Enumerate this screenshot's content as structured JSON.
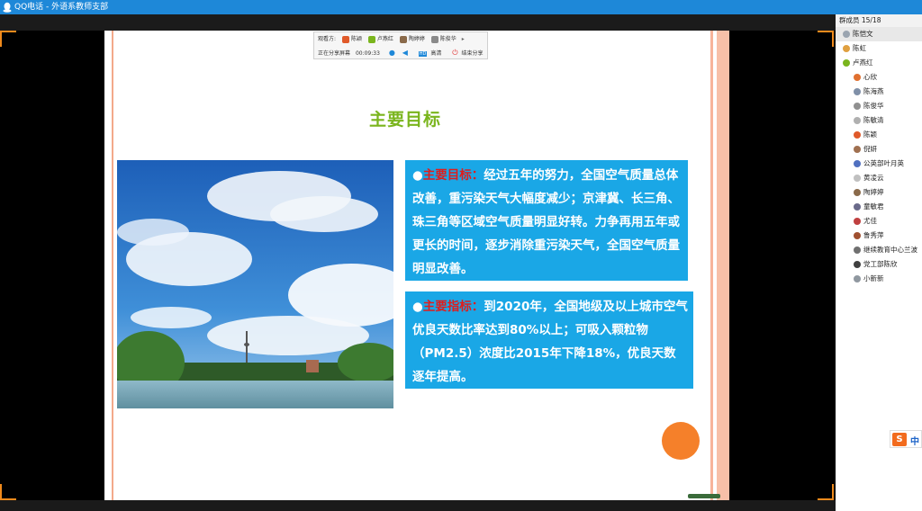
{
  "window": {
    "title": "QQ电话 - 外语系教师支部"
  },
  "share": {
    "viewers_label": "观看方:",
    "viewers": [
      {
        "name": "陈颖",
        "color": "#e05a2a"
      },
      {
        "name": "卢燕红",
        "color": "#7ab51d"
      },
      {
        "name": "陶婷婷",
        "color": "#8a6a4a"
      },
      {
        "name": "陈俊华",
        "color": "#8a8a8a"
      }
    ],
    "status": "正在分享屏幕",
    "time": "00:09:33",
    "quality": "高清",
    "end_label": "结束分享"
  },
  "slide": {
    "title": "主要目标",
    "box1_label": "主要目标：",
    "box1_text": "经过五年的努力，全国空气质量总体改善，重污染天气大幅度减少；京津冀、长三角、珠三角等区域空气质量明显好转。力争再用五年或更长的时间，逐步消除重污染天气，全国空气质量明显改善。",
    "box2_label": "主要指标：",
    "box2_text": "到2020年，全国地级及以上城市空气优良天数比率达到80%以上；可吸入颗粒物（PM2.5）浓度比2015年下降18%，优良天数逐年提高。"
  },
  "members": {
    "header": "群成员 15/18",
    "list": [
      {
        "name": "陈恺文",
        "color": "#9aa4b0",
        "indent": false,
        "selected": true
      },
      {
        "name": "陈虹",
        "color": "#e0a040",
        "indent": false
      },
      {
        "name": "卢燕红",
        "color": "#7ab51d",
        "indent": false
      },
      {
        "name": "心欣",
        "color": "#e07030",
        "indent": true
      },
      {
        "name": "陈海燕",
        "color": "#8090a8",
        "indent": true
      },
      {
        "name": "陈俊华",
        "color": "#909090",
        "indent": true
      },
      {
        "name": "陈敏清",
        "color": "#b0b0b0",
        "indent": true
      },
      {
        "name": "陈颖",
        "color": "#e05a2a",
        "indent": true
      },
      {
        "name": "倪妍",
        "color": "#a07050",
        "indent": true
      },
      {
        "name": "公英部叶月英",
        "color": "#5070c0",
        "indent": true
      },
      {
        "name": "黄凌云",
        "color": "#c0c0c0",
        "indent": true
      },
      {
        "name": "陶婷婷",
        "color": "#8a6a4a",
        "indent": true
      },
      {
        "name": "童敏君",
        "color": "#6a6a8a",
        "indent": true
      },
      {
        "name": "尤佳",
        "color": "#c04040",
        "indent": true
      },
      {
        "name": "鲁秀萍",
        "color": "#a05030",
        "indent": true
      },
      {
        "name": "继续教育中心兰波",
        "color": "#707070",
        "indent": true
      },
      {
        "name": "党工部陈欣",
        "color": "#404040",
        "indent": true
      },
      {
        "name": "小新新",
        "color": "#9098a0",
        "indent": true
      }
    ]
  },
  "ime": {
    "logo": "S",
    "mode": "中"
  }
}
